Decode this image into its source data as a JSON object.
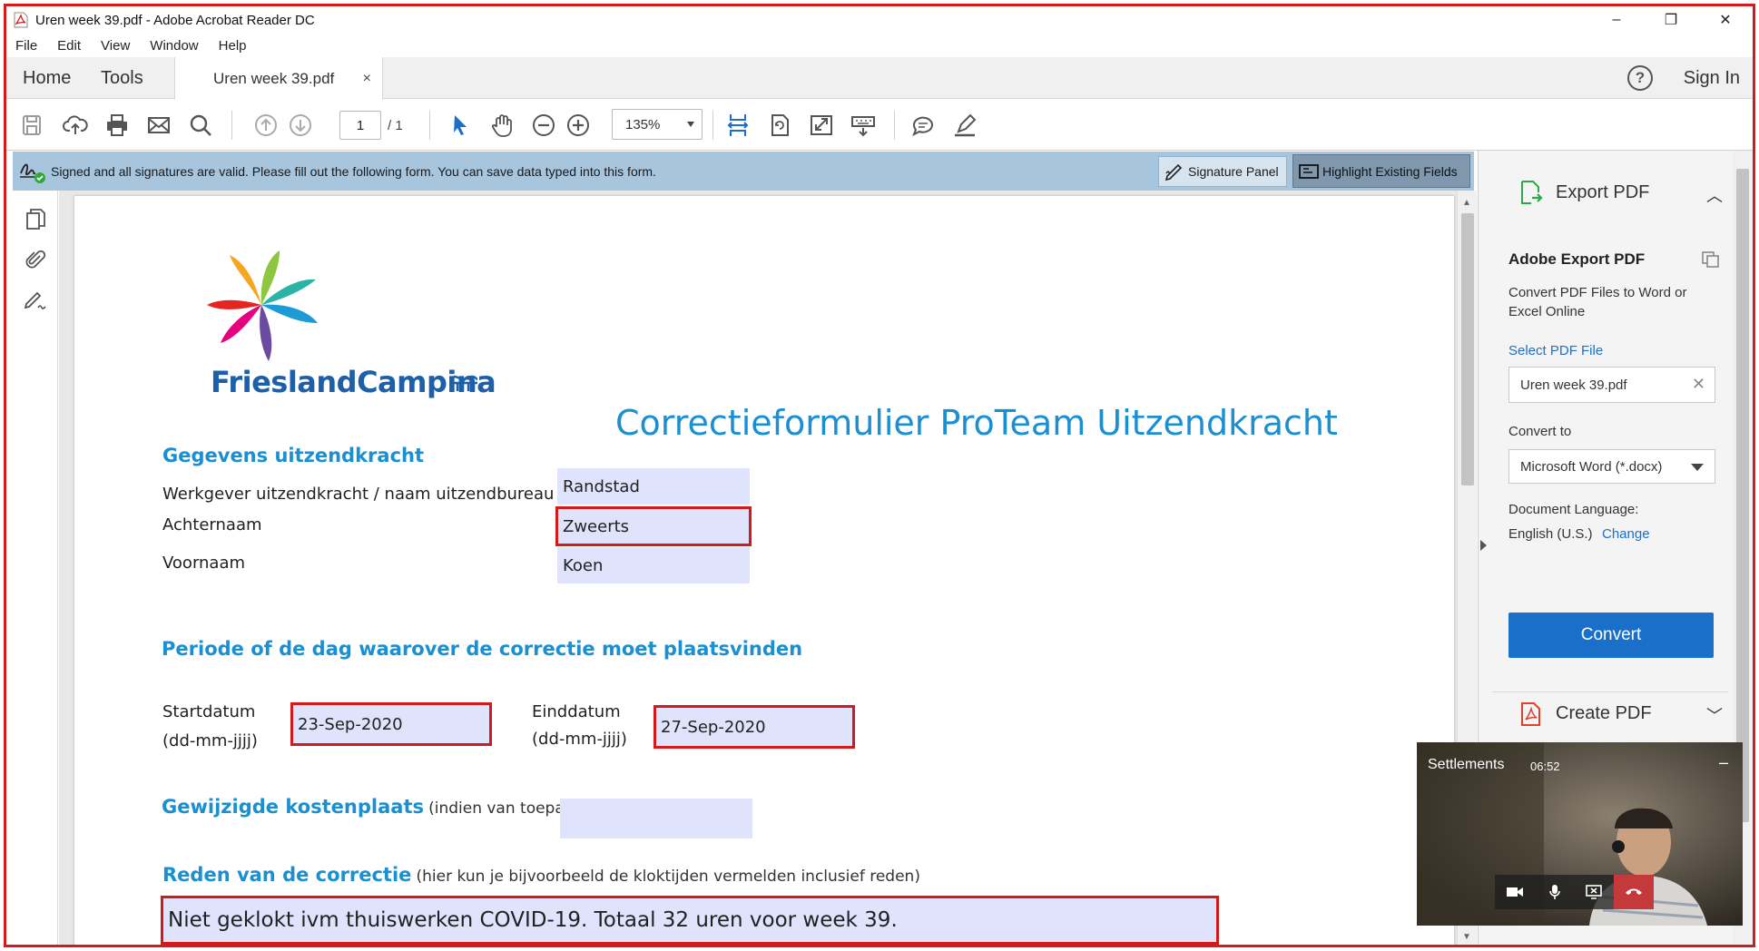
{
  "window": {
    "title": "Uren week 39.pdf - Adobe Acrobat Reader DC",
    "controls": [
      "–",
      "❐",
      "✕"
    ]
  },
  "menu": [
    "File",
    "Edit",
    "View",
    "Window",
    "Help"
  ],
  "tabs": {
    "home": "Home",
    "tools": "Tools",
    "document": "Uren week 39.pdf",
    "close": "×",
    "help": "?",
    "signin": "Sign In"
  },
  "toolbar": {
    "page_current": "1",
    "page_total": "/ 1",
    "zoom": "135%",
    "icons": [
      "save-icon",
      "upload-icon",
      "print-icon",
      "email-icon",
      "search-icon",
      "prev-page-icon",
      "next-page-icon",
      "select-cursor-icon",
      "hand-icon",
      "zoom-out-icon",
      "zoom-in-icon",
      "fit-page-icon",
      "rotate-icon",
      "fullscreen-icon",
      "keyboard-icon",
      "comment-icon",
      "highlighter-icon"
    ]
  },
  "notification": {
    "message": "Signed and all signatures are valid.  Please fill out the following form. You can save data typed into this form.",
    "signature_panel": "Signature Panel",
    "highlight_fields": "Highlight Existing Fields",
    "bar_color": "#a7c5dd"
  },
  "document": {
    "logo_text": "FrieslandCampina",
    "form_title": "Correctieformulier ProTeam Uitzendkracht",
    "section1_heading": "Gegevens uitzendkracht",
    "employer_label": "Werkgever uitzendkracht / naam uitzendbureau",
    "employer_value": "Randstad",
    "lastname_label": "Achternaam",
    "lastname_value": "Zweerts",
    "firstname_label": "Voornaam",
    "firstname_value": "Koen",
    "section2_heading": "Periode of de dag waarover de correctie moet plaatsvinden",
    "start_label": "Startdatum",
    "start_format": "(dd-mm-jjjj)",
    "start_value": "23-Sep-2020",
    "end_label": "Einddatum",
    "end_format": "(dd-mm-jjjj)",
    "end_value": "27-Sep-2020",
    "costcenter_heading": "Gewijzigde kostenplaats",
    "costcenter_note": "(indien van toepassing)",
    "costcenter_value": "",
    "reason_heading": "Reden van de correctie",
    "reason_note": "(hier kun je bijvoorbeeld de kloktijden vermelden inclusief reden)",
    "reason_value": "Niet geklokt ivm thuiswerken COVID-19. Totaal 32 uren voor week 39.",
    "field_color": "#dfe3fb",
    "highlight_color": "#d11a1a",
    "heading_color": "#1a8fd1"
  },
  "right_panel": {
    "export_header": "Export PDF",
    "title": "Adobe Export PDF",
    "description": "Convert PDF Files to Word or Excel Online",
    "select_label": "Select PDF File",
    "selected_file": "Uren week 39.pdf",
    "convert_to_label": "Convert to",
    "format": "Microsoft Word (*.docx)",
    "doc_language_label": "Document Language:",
    "doc_language": "English (U.S.)",
    "change_link": "Change",
    "convert_button": "Convert",
    "create_header": "Create PDF",
    "accent": "#1a6fc9"
  },
  "call": {
    "title": "Settlements",
    "duration": "06:52"
  }
}
